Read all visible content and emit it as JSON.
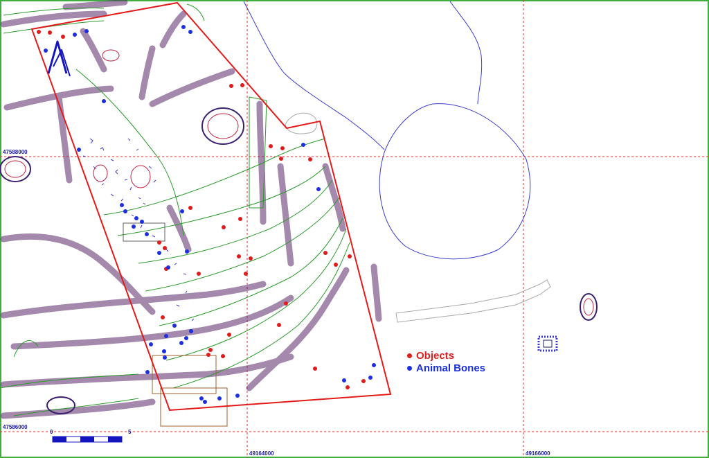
{
  "grid": {
    "x_labels": [
      "49164000",
      "49166000"
    ],
    "y_labels": [
      "47588000",
      "47586000"
    ]
  },
  "legend": {
    "items": [
      {
        "label": "Objects",
        "color": "#e01b1b"
      },
      {
        "label": "Animal Bones",
        "color": "#1c2fe0"
      }
    ]
  },
  "scale_bar": {
    "start_label": "0",
    "end_label": "5"
  },
  "colors": {
    "excavation_boundary": "#e41a1a",
    "grid_line": "#e03030",
    "pit_outline": "#3a3acc",
    "feature_green": "#2a9a2a",
    "feature_dark": "#3a2070",
    "border_green": "#3fae3f",
    "north_arrow": "#1515c0"
  },
  "north_arrow_icon": "north-arrow-icon"
}
